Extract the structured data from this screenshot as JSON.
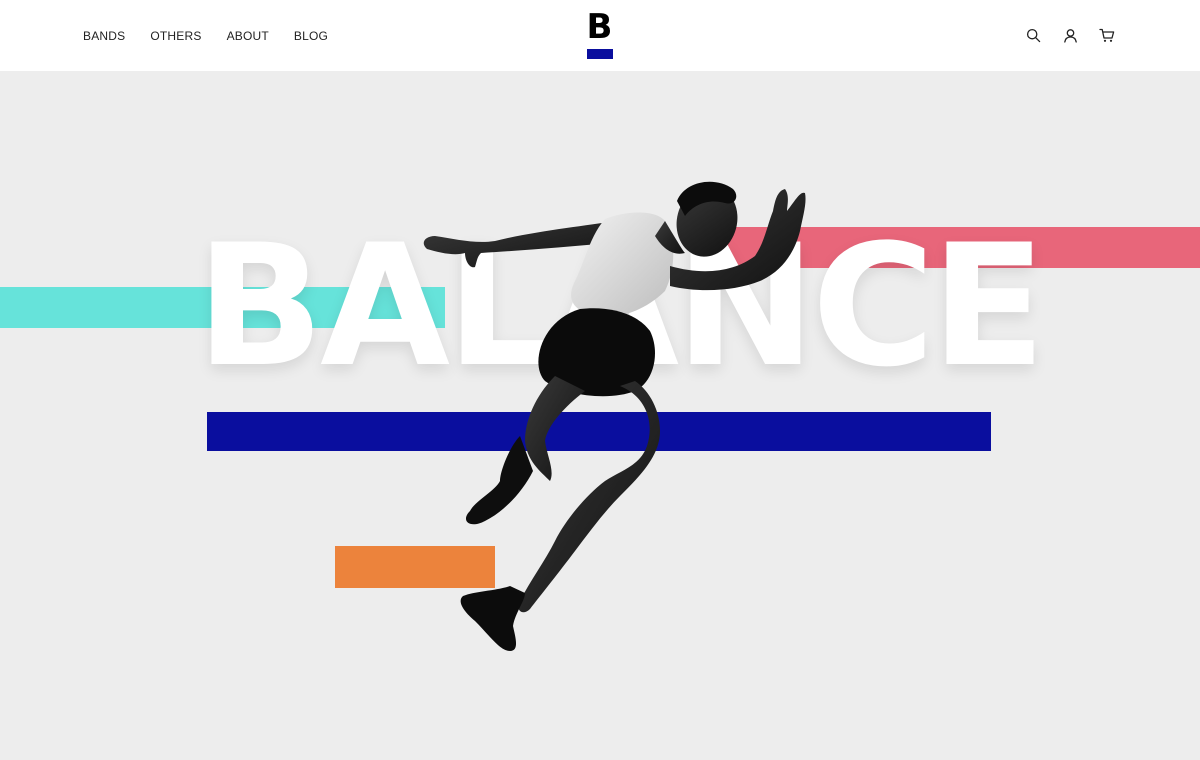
{
  "nav": {
    "items": [
      {
        "label": "BANDS"
      },
      {
        "label": "OTHERS"
      },
      {
        "label": "ABOUT"
      },
      {
        "label": "BLOG"
      }
    ]
  },
  "logo": {
    "letter": "B",
    "bar_color": "#0a0e9e"
  },
  "actions": {
    "icons": [
      "search-icon",
      "user-icon",
      "cart-icon"
    ]
  },
  "hero": {
    "title": "BALANCE",
    "image": "sprinting-athlete-silhouette",
    "stripe_colors": {
      "teal": "#66e3da",
      "pink": "#e8667a",
      "blue": "#0a0e9e",
      "orange": "#ec833c"
    }
  }
}
